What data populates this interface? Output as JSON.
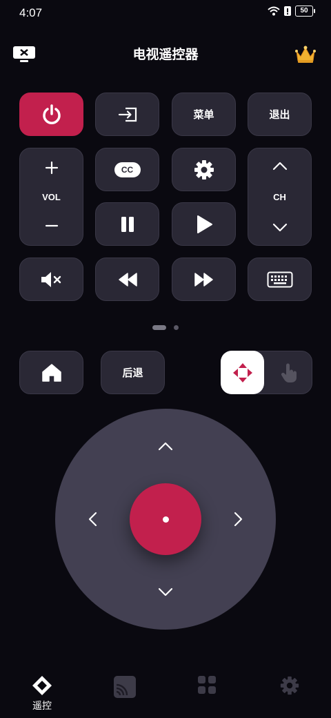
{
  "status": {
    "time": "4:07",
    "battery": "50"
  },
  "header": {
    "title": "电视遥控器"
  },
  "buttons": {
    "menu": "菜单",
    "exit": "退出",
    "vol": "VOL",
    "ch": "CH",
    "cc": "CC",
    "back": "后退"
  },
  "nav": {
    "remote_label": "遥控"
  },
  "colors": {
    "accent": "#c2204d",
    "background": "#0a0910",
    "tile": "#2a2835",
    "dpad": "#434052"
  },
  "icons": [
    "tv-cast-icon",
    "crown-icon",
    "power-icon",
    "input-icon",
    "settings-gear-icon",
    "pause-icon",
    "play-icon",
    "mute-icon",
    "rewind-icon",
    "fast-forward-icon",
    "keyboard-icon",
    "home-icon",
    "dpad-mode-icon",
    "touchpad-mode-icon"
  ]
}
